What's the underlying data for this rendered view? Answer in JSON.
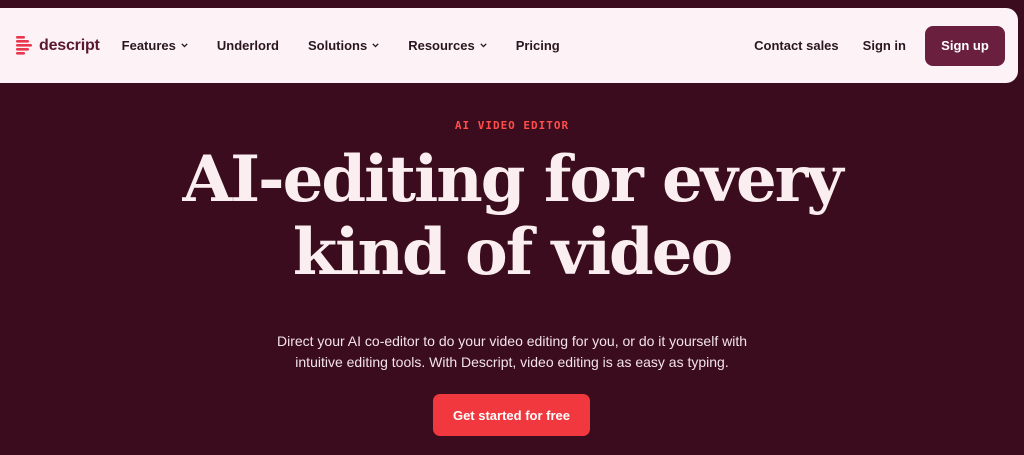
{
  "brand": {
    "name": "descript",
    "accent": "#f0383e",
    "background": "#3a0c1d",
    "signup_color": "#6a1f3e"
  },
  "nav": {
    "items": [
      {
        "label": "Features",
        "has_dropdown": true
      },
      {
        "label": "Underlord",
        "has_dropdown": false
      },
      {
        "label": "Solutions",
        "has_dropdown": true
      },
      {
        "label": "Resources",
        "has_dropdown": true
      },
      {
        "label": "Pricing",
        "has_dropdown": false
      }
    ],
    "contact_sales": "Contact sales",
    "sign_in": "Sign in",
    "sign_up": "Sign up"
  },
  "hero": {
    "eyebrow": "AI VIDEO EDITOR",
    "headline_line1": "AI-editing for every",
    "headline_line2": "kind of video",
    "subtext_line1": "Direct your AI co-editor to do your video editing for you, or do it yourself with",
    "subtext_line2": "intuitive editing tools. With Descript, video editing is as easy as typing.",
    "cta": "Get started for free"
  },
  "icons": {
    "logo": "descript-logo-icon",
    "dropdown": "chevron-down-icon"
  }
}
